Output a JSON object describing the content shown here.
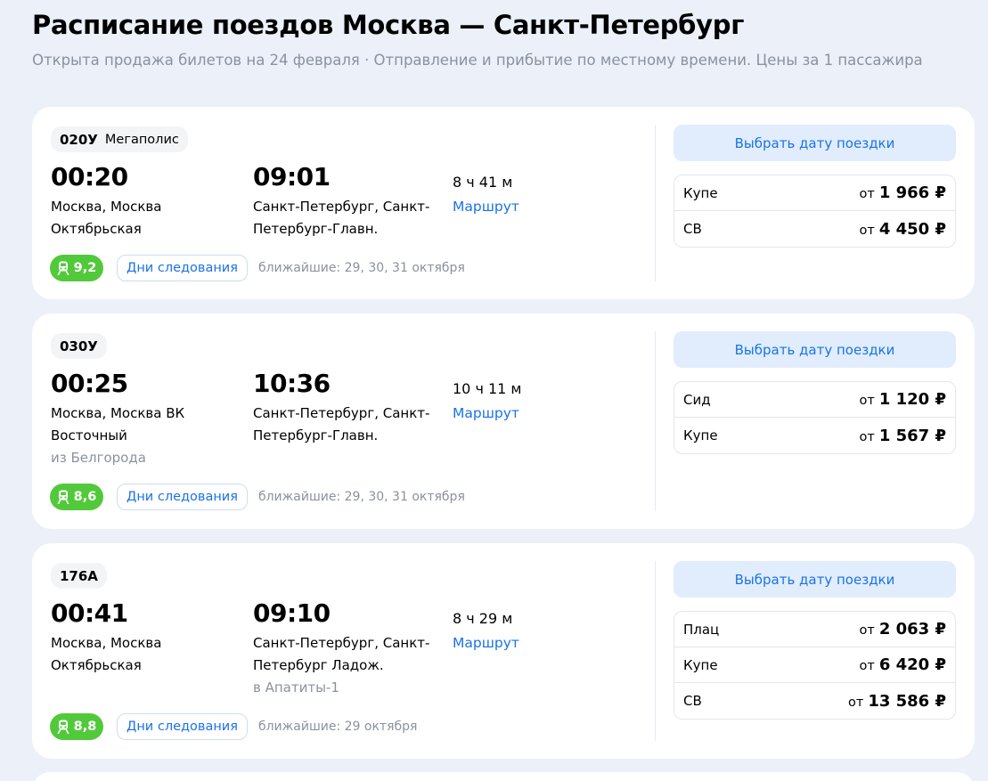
{
  "page": {
    "title": "Расписание поездов Москва — Санкт-Петербург",
    "subtitle": "Открыта продажа билетов на 24 февраля · Отправление и прибытие по местному времени. Цены за 1 пассажира"
  },
  "trains": [
    {
      "number": "020У",
      "name": "Мегаполис",
      "departure_time": "00:20",
      "departure_station": "Москва, Москва Октябрьская",
      "departure_note": "",
      "arrival_time": "09:01",
      "arrival_station": "Санкт-Петербург, Санкт-Петербург-Главн.",
      "arrival_note": "",
      "duration": "8 ч 41 м",
      "route_link": "Маршрут",
      "rating": "9,2",
      "days_button": "Дни следования",
      "nearest_dates": "ближайшие: 29, 30, 31 октября",
      "date_button": "Выбрать дату поездки",
      "prices": [
        {
          "class": "Купе",
          "from": "от",
          "price": "1 966 ₽"
        },
        {
          "class": "СВ",
          "from": "от",
          "price": "4 450 ₽"
        }
      ]
    },
    {
      "number": "030У",
      "name": "",
      "departure_time": "00:25",
      "departure_station": "Москва, Москва ВК Восточный",
      "departure_note": "из Белгорода",
      "arrival_time": "10:36",
      "arrival_station": "Санкт-Петербург, Санкт-Петербург-Главн.",
      "arrival_note": "",
      "duration": "10 ч 11 м",
      "route_link": "Маршрут",
      "rating": "8,6",
      "days_button": "Дни следования",
      "nearest_dates": "ближайшие: 29, 30, 31 октября",
      "date_button": "Выбрать дату поездки",
      "prices": [
        {
          "class": "Сид",
          "from": "от",
          "price": "1 120 ₽"
        },
        {
          "class": "Купе",
          "from": "от",
          "price": "1 567 ₽"
        }
      ]
    },
    {
      "number": "176А",
      "name": "",
      "departure_time": "00:41",
      "departure_station": "Москва, Москва Октябрьская",
      "departure_note": "",
      "arrival_time": "09:10",
      "arrival_station": "Санкт-Петербург, Санкт-Петербург Ладож.",
      "arrival_note": "в Апатиты-1",
      "duration": "8 ч 29 м",
      "route_link": "Маршрут",
      "rating": "8,8",
      "days_button": "Дни следования",
      "nearest_dates": "ближайшие: 29 октября",
      "date_button": "Выбрать дату поездки",
      "prices": [
        {
          "class": "Плац",
          "from": "от",
          "price": "2 063 ₽"
        },
        {
          "class": "Купе",
          "from": "от",
          "price": "6 420 ₽"
        },
        {
          "class": "СВ",
          "from": "от",
          "price": "13 586 ₽"
        }
      ]
    }
  ],
  "icons": {
    "rating": "train-icon"
  },
  "colors": {
    "background": "#ebf0f9",
    "accent": "#1a73e8",
    "rating": "#52c93b",
    "date_button_bg": "#e1edfd",
    "muted_text": "#8a929e"
  }
}
